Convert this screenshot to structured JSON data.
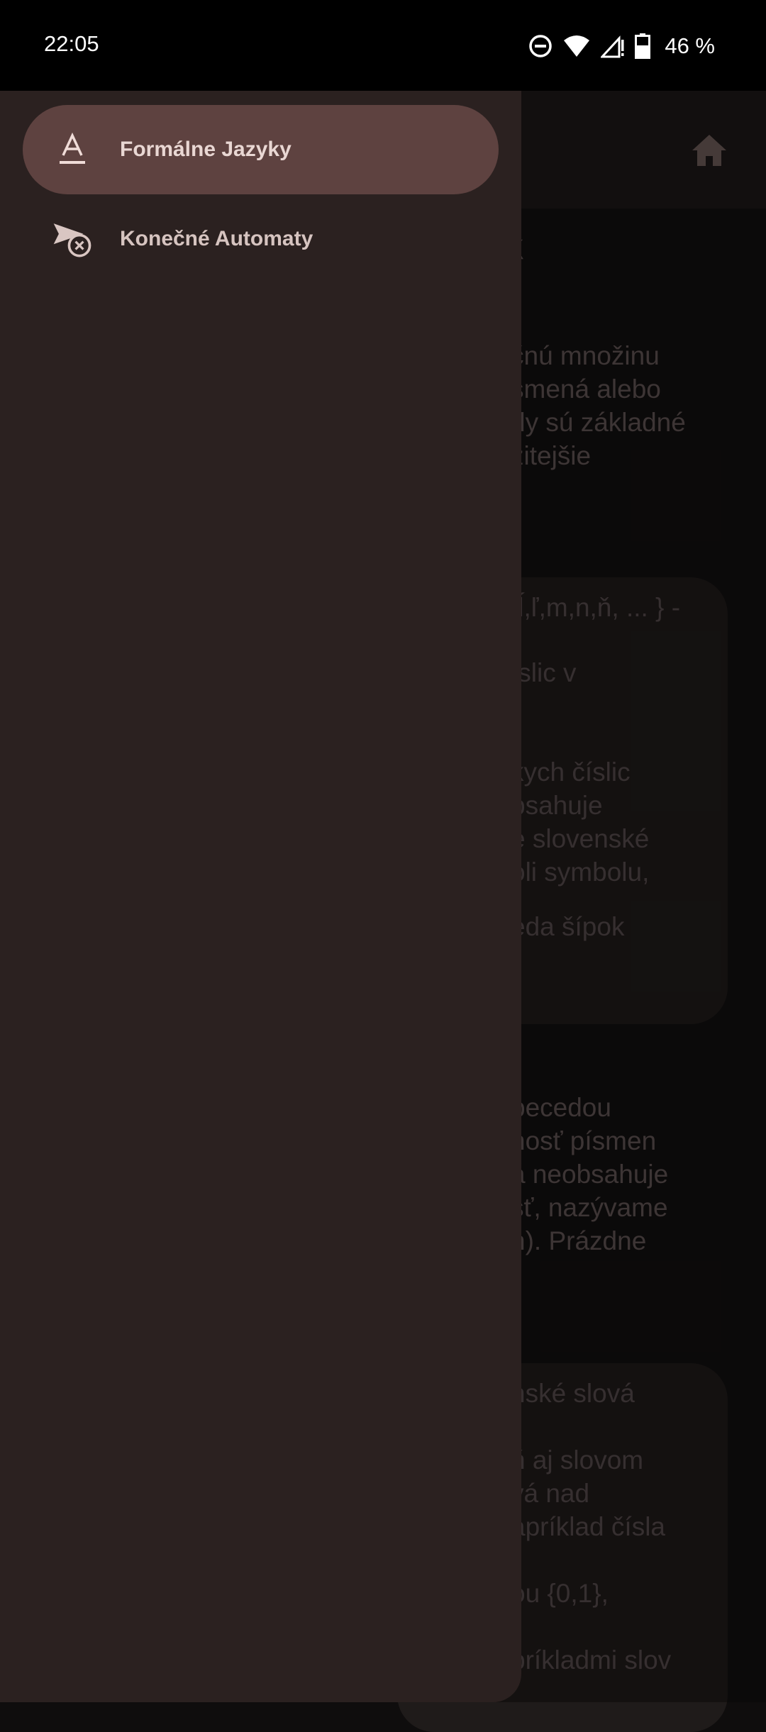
{
  "status_bar": {
    "time": "22:05",
    "battery": "46 %",
    "icons": [
      "do-not-disturb-icon",
      "wifi-icon",
      "signal-icon",
      "battery-icon"
    ]
  },
  "background": {
    "heading_fragment": "yk",
    "para1": [
      "čnú množinu",
      "smená alebo",
      "dy sú základné",
      "žitejšie"
    ],
    "card1": [
      ",ĺ,ľ,m,n,ň, ... } -",
      "íslic v",
      "kych číslic",
      "bsahuje",
      "e slovenské",
      "oli symbolu,",
      "eda šípok"
    ],
    "para2": [
      "becedou",
      "nosť písmen",
      "á neobsahuje",
      "sť, nazývame",
      "n). Prázdne"
    ],
    "card2": [
      "nské slová",
      "ň aj slovom",
      "vá nad",
      "apríklad čísla",
      "ou {0,1},",
      "príkladmi slov"
    ]
  },
  "drawer": {
    "items": [
      {
        "label": "Formálne Jazyky",
        "icon": "text-format-icon",
        "active": true
      },
      {
        "label": "Konečné Automaty",
        "icon": "automaton-icon",
        "active": false
      }
    ]
  },
  "colors": {
    "drawer_bg": "#2b2120",
    "active_item_bg": "#5e4240",
    "status_bar_bg": "#000000"
  }
}
